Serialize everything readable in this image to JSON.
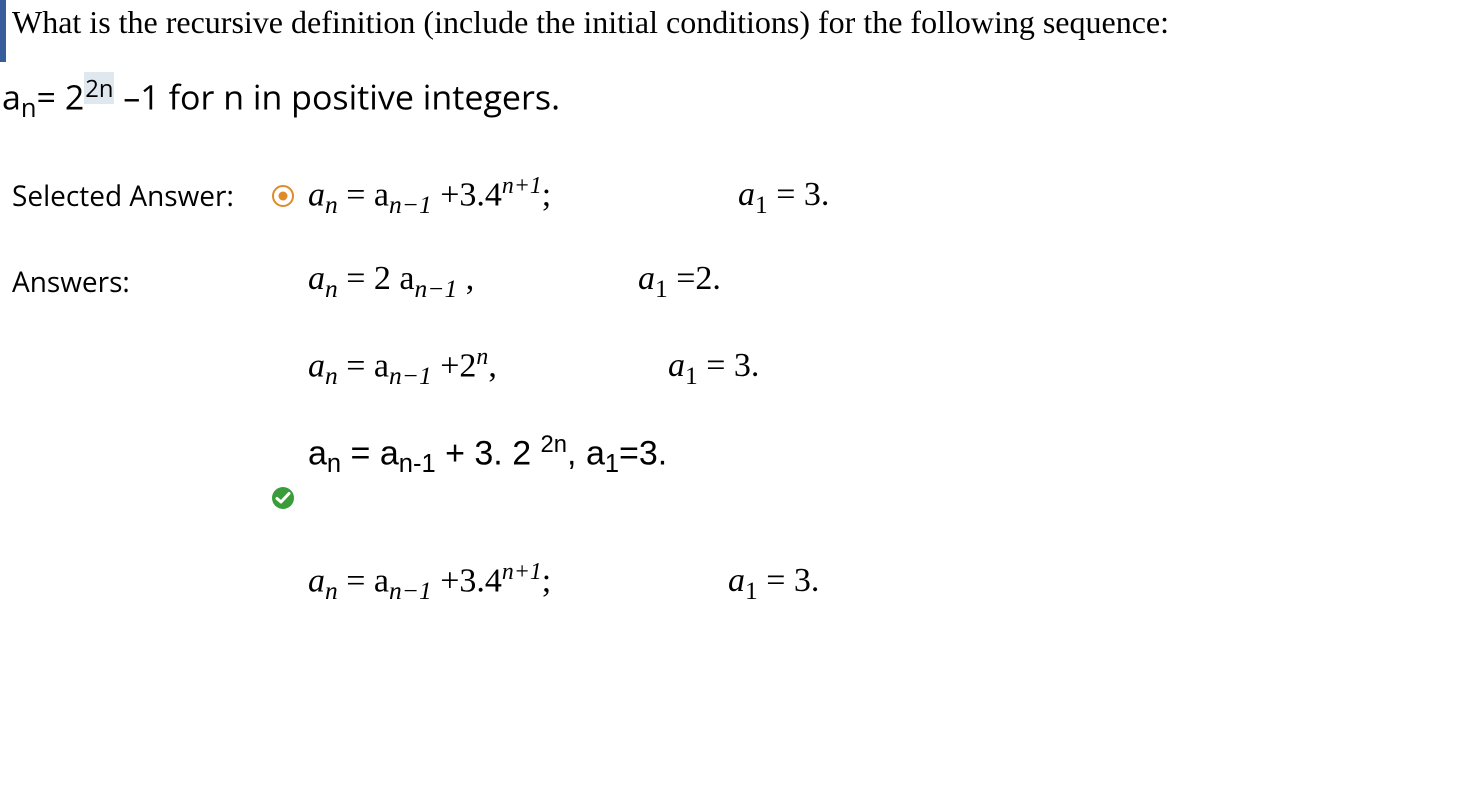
{
  "question": {
    "prompt": "What is the recursive definition (include the initial conditions) for the following sequence:",
    "formula": {
      "lhs_a": "a",
      "lhs_sub": "n",
      "eq": "= 2",
      "exp": "2n",
      "tail": " –1 for n in positive integers."
    }
  },
  "labels": {
    "selected": "Selected Answer:",
    "answers": "Answers:"
  },
  "selected_answer": {
    "status": "incorrect",
    "eq_lhs": "a",
    "eq_lhs_sub": "n",
    "eq_mid": " =  a",
    "eq_mid_sub": "n−1",
    "eq_tail1": " +3.4",
    "eq_sup": "n+1",
    "eq_tail2": ";",
    "init_lhs": "a",
    "init_sub": "1",
    "init_rhs": " = 3."
  },
  "answers": [
    {
      "status": "none",
      "eq_lhs": "a",
      "eq_lhs_sub": "n",
      "eq_mid": " =  2 a",
      "eq_mid_sub": "n−1",
      "eq_tail1": " ,",
      "eq_sup": "",
      "eq_tail2": "",
      "init_lhs": "a",
      "init_sub": "1",
      "init_rhs": " =2."
    },
    {
      "status": "none",
      "eq_lhs": "a",
      "eq_lhs_sub": "n",
      "eq_mid": " =  a",
      "eq_mid_sub": "n−1",
      "eq_tail1": " +2",
      "eq_sup": "n",
      "eq_tail2": ",",
      "init_lhs": "a",
      "init_sub": "1",
      "init_rhs": " = 3."
    },
    {
      "status": "correct",
      "upright": true,
      "eq_lhs": "a",
      "eq_lhs_sub": "n",
      "eq_mid": " = a",
      "eq_mid_sub": "n-1",
      "eq_tail1": " + 3. 2 ",
      "eq_sup": "2n",
      "eq_tail2": ", ",
      "init_lhs": "a",
      "init_sub": "1",
      "init_rhs": "=3."
    },
    {
      "status": "none",
      "eq_lhs": "a",
      "eq_lhs_sub": "n",
      "eq_mid": " =  a",
      "eq_mid_sub": "n−1",
      "eq_tail1": " +3.4",
      "eq_sup": "n+1",
      "eq_tail2": ";",
      "init_lhs": "a",
      "init_sub": "1",
      "init_rhs": " = 3."
    }
  ],
  "icons": {
    "incorrect_name": "incorrect-icon",
    "correct_name": "correct-icon"
  }
}
